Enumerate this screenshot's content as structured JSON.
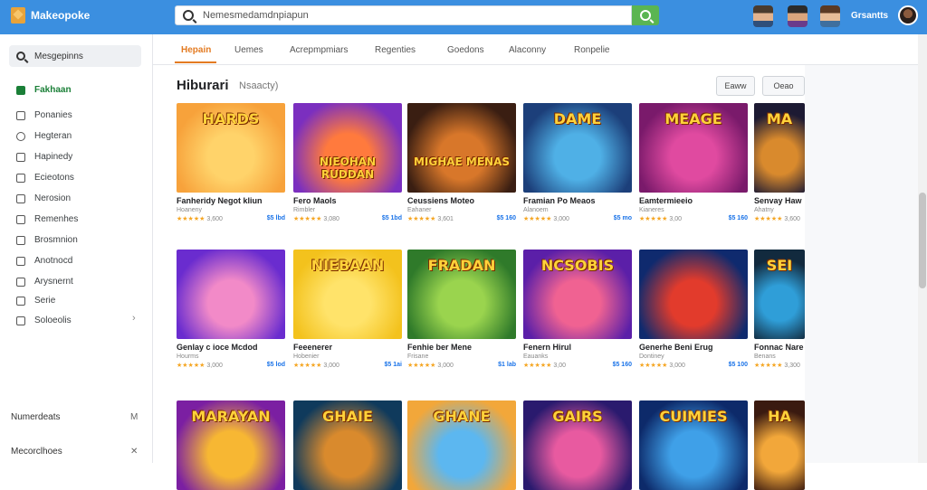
{
  "app": {
    "logo_text": "Makeopoke"
  },
  "search": {
    "value": "Nemesmedamdnpiapun"
  },
  "topbar": {
    "user_label": "Grsantts"
  },
  "sidebar": {
    "search_label": "Mesgepinns",
    "items": [
      {
        "label": "Fakhaan",
        "icon": "store-icon"
      },
      {
        "label": "Ponanies",
        "icon": "grid-icon"
      },
      {
        "label": "Hegteran",
        "icon": "compass-icon"
      },
      {
        "label": "Hapinedy",
        "icon": "tag-icon"
      },
      {
        "label": "Ecieotons",
        "icon": "layers-icon"
      },
      {
        "label": "Nerosion",
        "icon": "ticket-icon"
      },
      {
        "label": "Remenhes",
        "icon": "list-icon"
      },
      {
        "label": "Brosmnion",
        "icon": "calendar-icon"
      },
      {
        "label": "Anotnocd",
        "icon": "house-icon"
      },
      {
        "label": "Arysnernt",
        "icon": "arrow-icon"
      },
      {
        "label": "Serie",
        "icon": "box-icon"
      },
      {
        "label": "Soloeolis",
        "icon": "folder-icon"
      }
    ],
    "footer": [
      {
        "label": "Numerdeats",
        "mark": "M"
      },
      {
        "label": "Mecorclhoes",
        "mark": "✕"
      }
    ]
  },
  "tabs": [
    "Hepain",
    "Uemes",
    "Acrepmpmiars",
    "Regenties",
    "Goedons",
    "Alaconny",
    "Ronpelie"
  ],
  "section": {
    "title": "Hiburari",
    "subtitle": "Nsaacty)",
    "buttons": [
      "Eaww",
      "Oeao"
    ]
  },
  "cards": [
    {
      "title": "Fanheridy Negot kliun",
      "sub": "Hoaneny",
      "rating": "3,600",
      "price": "$5 lbd",
      "art": "HARDS",
      "bg": [
        "#f7a23b",
        "#ffd36a"
      ]
    },
    {
      "title": "Fero Maols",
      "sub": "Rimbler",
      "rating": "3,080",
      "price": "$5 1bd",
      "art": "NIEOHAN RUDDAN",
      "bg": [
        "#7b2fbf",
        "#ff7a3d"
      ]
    },
    {
      "title": "Ceussiens Moteo",
      "sub": "Eahaner",
      "rating": "3,601",
      "price": "$5 160",
      "art": "MIGHAE MENAS",
      "bg": [
        "#3a1e12",
        "#d8772a"
      ]
    },
    {
      "title": "Framian Po Meaos",
      "sub": "Alanoem",
      "rating": "3,000",
      "price": "$5 mo",
      "art": "DAME",
      "bg": [
        "#1c3f7a",
        "#4fb0e6"
      ]
    },
    {
      "title": "Eamtermieeio",
      "sub": "Kianeres",
      "rating": "3,00",
      "price": "$5 160",
      "art": "MEAGE",
      "bg": [
        "#7a1a6b",
        "#e04aa0"
      ]
    },
    {
      "title": "Senvay Haw",
      "sub": "Ahatny",
      "rating": "3,600",
      "price": "",
      "art": "MA",
      "bg": [
        "#1d1a33",
        "#d98a2d"
      ]
    },
    {
      "title": "Genlay c ioce Mcdod",
      "sub": "Hourms",
      "rating": "3,000",
      "price": "$5 lod",
      "art": "",
      "bg": [
        "#6a2ccf",
        "#f28ac8"
      ]
    },
    {
      "title": "Feeenerer",
      "sub": "Hobenier",
      "rating": "3,000",
      "price": "$5 1ai",
      "art": "NIEBAAN",
      "bg": [
        "#f3c21d",
        "#ffe36a"
      ]
    },
    {
      "title": "Fenhie ber Mene",
      "sub": "Frisane",
      "rating": "3,000",
      "price": "$1 lab",
      "art": "FRADAN",
      "bg": [
        "#2f7a2a",
        "#9ad44e"
      ]
    },
    {
      "title": "Fenern Hirul",
      "sub": "Eauanks",
      "rating": "3,00",
      "price": "$5 160",
      "art": "NCSOBIS",
      "bg": [
        "#5b1fa8",
        "#f06292"
      ]
    },
    {
      "title": "Generhe Beni Erug",
      "sub": "Dontiney",
      "rating": "3,000",
      "price": "$5 100",
      "art": "",
      "bg": [
        "#0f2a6e",
        "#e23b2c"
      ]
    },
    {
      "title": "Fonnac Nare",
      "sub": "Benans",
      "rating": "3,300",
      "price": "",
      "art": "SEI",
      "bg": [
        "#122a3e",
        "#2f9ed8"
      ]
    },
    {
      "title": "",
      "sub": "",
      "rating": "",
      "price": "",
      "art": "MARAYAN",
      "bg": [
        "#7b1fa2",
        "#f7b733"
      ]
    },
    {
      "title": "",
      "sub": "",
      "rating": "",
      "price": "",
      "art": "GHAIE",
      "bg": [
        "#0f3a5c",
        "#d98a2d"
      ]
    },
    {
      "title": "",
      "sub": "",
      "rating": "",
      "price": "",
      "art": "GHANE",
      "bg": [
        "#f2a73a",
        "#5cb7f0"
      ]
    },
    {
      "title": "",
      "sub": "",
      "rating": "",
      "price": "",
      "art": "GAIRS",
      "bg": [
        "#2a1a6e",
        "#e85aa0"
      ]
    },
    {
      "title": "",
      "sub": "",
      "rating": "",
      "price": "",
      "art": "CUIMIES",
      "bg": [
        "#0d2a6a",
        "#3fa0e8"
      ]
    },
    {
      "title": "",
      "sub": "",
      "rating": "",
      "price": "",
      "art": "HA",
      "bg": [
        "#3a1a10",
        "#f2a73a"
      ]
    }
  ]
}
